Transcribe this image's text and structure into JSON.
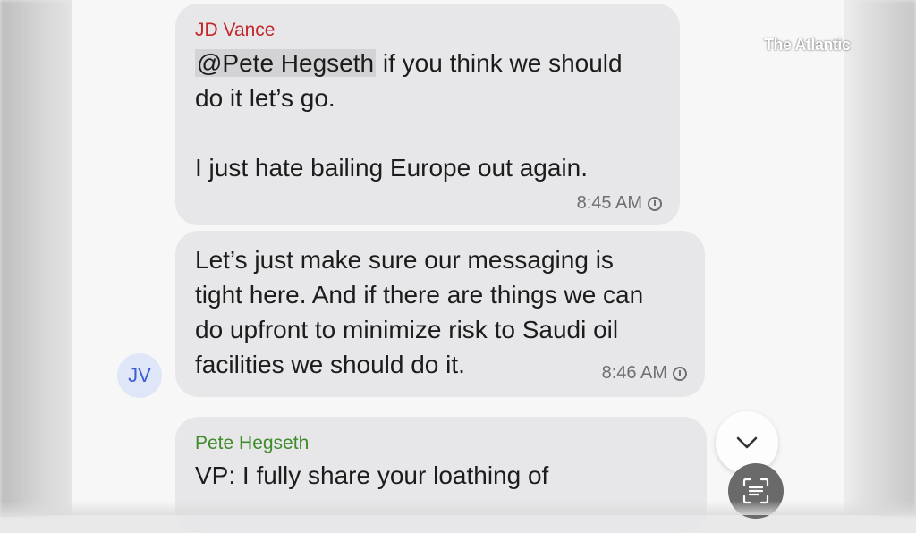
{
  "watermark": "The Atlantic",
  "messages": [
    {
      "sender": "JD Vance",
      "sender_color": "#c2262a",
      "mention": "@Pete Hegseth",
      "line1_rest": " if you think we should",
      "line2": "do it let’s go.",
      "line3": "I just hate bailing Europe out again.",
      "time": "8:45 AM"
    },
    {
      "lines": [
        "Let’s just make sure our messaging is",
        "tight here. And if there are things we can",
        "do upfront to minimize risk to Saudi oil",
        "facilities we should do it."
      ],
      "time": "8:46 AM",
      "avatar_initials": "JV"
    },
    {
      "sender": "Pete Hegseth",
      "sender_color": "#3f8b2a",
      "line1": "VP: I fully share your loathing of"
    }
  ],
  "controls": {
    "scroll_down_icon": "chevron-down-icon",
    "scan_icon": "text-scan-icon"
  }
}
